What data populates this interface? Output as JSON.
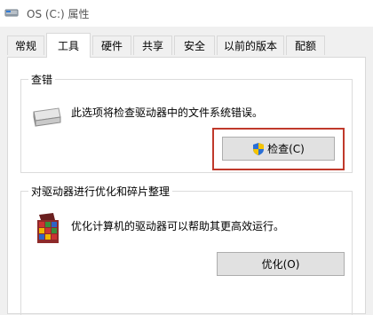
{
  "window": {
    "title": "OS (C:) 属性"
  },
  "tabs": [
    {
      "label": "常规",
      "active": false
    },
    {
      "label": "工具",
      "active": true
    },
    {
      "label": "硬件",
      "active": false
    },
    {
      "label": "共享",
      "active": false
    },
    {
      "label": "安全",
      "active": false
    },
    {
      "label": "以前的版本",
      "active": false
    },
    {
      "label": "配额",
      "active": false
    }
  ],
  "error_check": {
    "title": "查错",
    "description": "此选项将检查驱动器中的文件系统错误。",
    "button_label": "检查(C)",
    "icon": "drive-icon",
    "button_icon": "uac-shield-icon"
  },
  "optimize": {
    "title": "对驱动器进行优化和碎片整理",
    "description": "优化计算机的驱动器可以帮助其更高效运行。",
    "button_label": "优化(O)",
    "icon": "defrag-icon"
  },
  "colors": {
    "highlight_border": "#c0392b",
    "button_bg": "#e1e1e1",
    "window_bg": "#f0f0f0"
  }
}
